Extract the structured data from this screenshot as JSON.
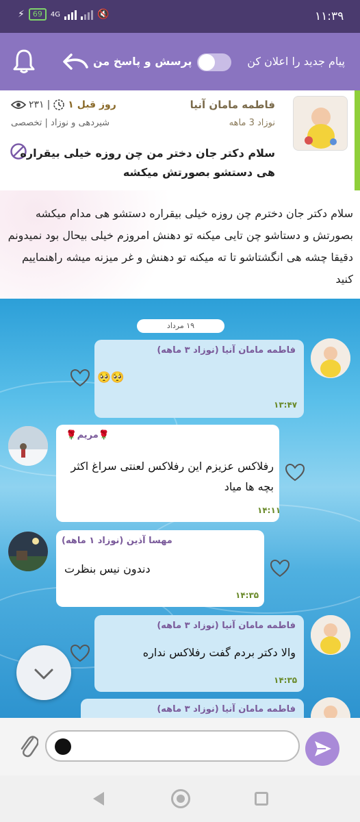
{
  "statusbar": {
    "time": "۱۱:۳۹",
    "battery": "69",
    "network": "4G"
  },
  "toolbar": {
    "notify_label": "پیام جدید را اعلان کن",
    "qa_label": "پرسش و پاسخ من",
    "toggle_on": false
  },
  "question": {
    "author": "فاطمه مامان آنیا",
    "age": "نوزاد 3 ماهه",
    "time_ago": "۱ روز قبل",
    "views": "۲۳۱",
    "category": "شیردهی و نوزاد | تخصصی",
    "title": "سلام دکتر جان دختر من چن روزه خیلی بیقراره هی دستشو بصورتش میکشه",
    "body": "سلام  دکتر جان دخترم چن روزه خیلی بیقراره دستشو هی مدام میکشه بصورتش و دستاشو چن تایی میکنه تو دهنش امروزم خیلی بیحال بود نمیدونم دقیقا چشه هی انگشتاشو تا ته میکنه تو دهنش و غر میزنه  میشه راهنماییم کنید"
  },
  "chat": {
    "date": "۱۹ مرداد",
    "messages": [
      {
        "sender": "فاطمه مامان آنیا (نوزاد ۳ ماهه)",
        "text": "🥺🥺",
        "time": "۱۳:۴۷",
        "mine": true
      },
      {
        "sender": "🌹مریم🌹",
        "text": "رفلاکس عزیزم این رفلاکس لعنتی سراغ اکثر بچه ها میاد",
        "time": "۱۴:۱۱",
        "mine": false
      },
      {
        "sender": "مهسا آذین (نوزاد ۱ ماهه)",
        "text": "دندون نیس بنظرت",
        "time": "۱۴:۳۵",
        "mine": false
      },
      {
        "sender": "فاطمه مامان آنیا (نوزاد ۳ ماهه)",
        "text": "والا دکتر بردم گفت رفلاکس نداره",
        "time": "۱۴:۳۵",
        "mine": true
      },
      {
        "sender": "فاطمه مامان آنیا (نوزاد ۳ ماهه)",
        "text": "",
        "time": "",
        "mine": true
      }
    ]
  },
  "input": {
    "placeholder": "",
    "value": ""
  },
  "colors": {
    "toolbar": "#8a74c0",
    "accent_green": "#8fcf3a",
    "send": "#a98ad8"
  }
}
